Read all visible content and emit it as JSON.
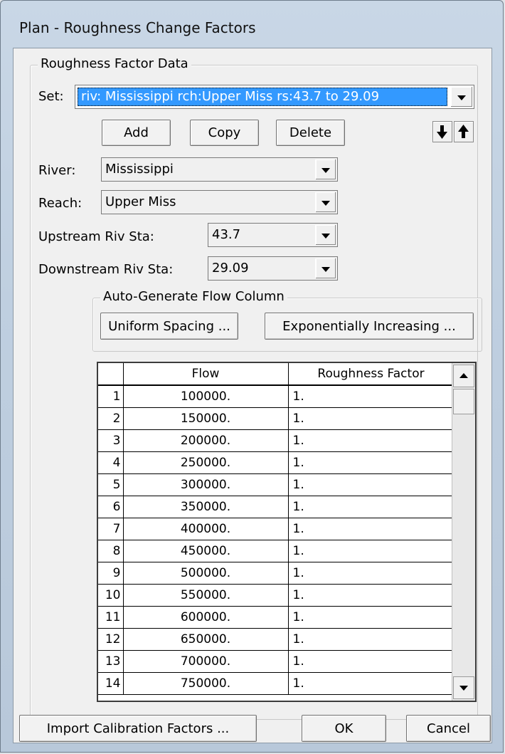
{
  "window": {
    "title": "Plan - Roughness Change Factors"
  },
  "group_roughness": {
    "legend": "Roughness Factor Data"
  },
  "set": {
    "label": "Set:",
    "value": "riv: Mississippi rch:Upper Miss rs:43.7  to 29.09"
  },
  "buttons": {
    "add": "Add",
    "copy": "Copy",
    "delete": "Delete"
  },
  "river": {
    "label": "River:",
    "value": "Mississippi"
  },
  "reach": {
    "label": "Reach:",
    "value": "Upper Miss"
  },
  "upstream": {
    "label": "Upstream Riv Sta:",
    "value": "43.7"
  },
  "downstream": {
    "label": "Downstream Riv Sta:",
    "value": "29.09"
  },
  "auto_generate": {
    "legend": "Auto-Generate Flow Column",
    "uniform": "Uniform Spacing ...",
    "exponential": "Exponentially Increasing ..."
  },
  "table": {
    "columns": [
      "Flow",
      "Roughness Factor"
    ],
    "rows": [
      {
        "n": "1",
        "flow": "100000.",
        "factor": "1."
      },
      {
        "n": "2",
        "flow": "150000.",
        "factor": "1."
      },
      {
        "n": "3",
        "flow": "200000.",
        "factor": "1."
      },
      {
        "n": "4",
        "flow": "250000.",
        "factor": "1."
      },
      {
        "n": "5",
        "flow": "300000.",
        "factor": "1."
      },
      {
        "n": "6",
        "flow": "350000.",
        "factor": "1."
      },
      {
        "n": "7",
        "flow": "400000.",
        "factor": "1."
      },
      {
        "n": "8",
        "flow": "450000.",
        "factor": "1."
      },
      {
        "n": "9",
        "flow": "500000.",
        "factor": "1."
      },
      {
        "n": "10",
        "flow": "550000.",
        "factor": "1."
      },
      {
        "n": "11",
        "flow": "600000.",
        "factor": "1."
      },
      {
        "n": "12",
        "flow": "650000.",
        "factor": "1."
      },
      {
        "n": "13",
        "flow": "700000.",
        "factor": "1."
      },
      {
        "n": "14",
        "flow": "750000.",
        "factor": "1."
      }
    ]
  },
  "footer": {
    "import": "Import Calibration Factors ...",
    "ok": "OK",
    "cancel": "Cancel"
  },
  "colors": {
    "selection": "#3399ff",
    "dialog_bg": "#f0f0f0"
  }
}
